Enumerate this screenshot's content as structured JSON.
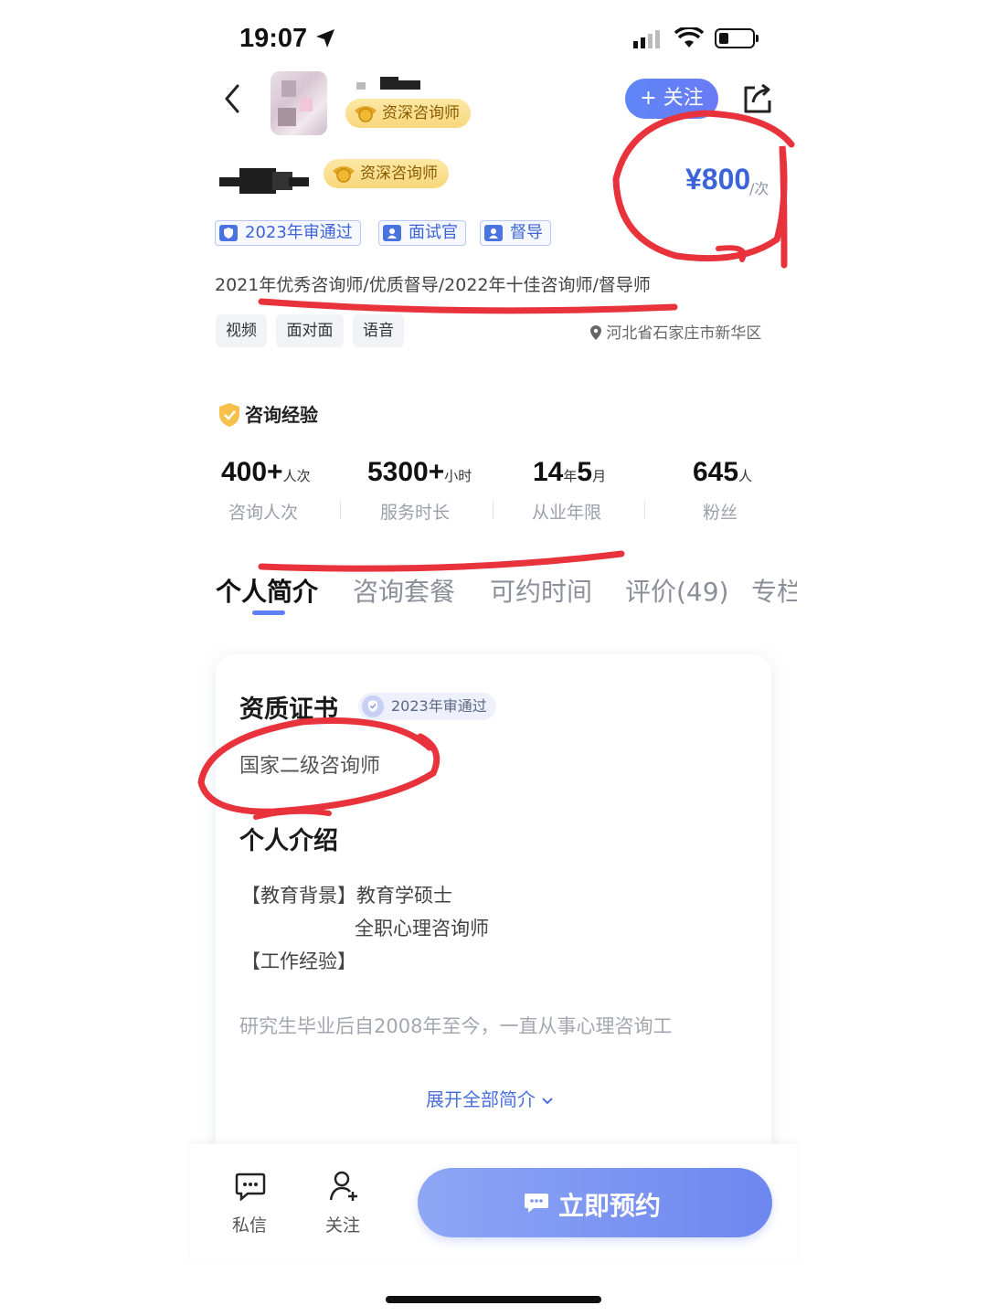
{
  "status_bar": {
    "time": "19:07"
  },
  "header": {
    "title_badge": "资深咨询师",
    "follow_label": "+ 关注"
  },
  "profile": {
    "title_badge": "资深咨询师",
    "price": "¥800",
    "price_unit": "/次",
    "tags": [
      "2023年审通过",
      "面试官",
      "督导"
    ],
    "honors": "2021年优秀咨询师/优质督导/2022年十佳咨询师/督导师",
    "modes": [
      "视频",
      "面对面",
      "语音"
    ],
    "location": "河北省石家庄市新华区"
  },
  "experience": {
    "title": "咨询经验",
    "stats": [
      {
        "value": "400+",
        "unit": "人次",
        "label": "咨询人次"
      },
      {
        "value": "5300+",
        "unit": "小时",
        "label": "服务时长"
      },
      {
        "value_a": "14",
        "unit_a": "年",
        "value_b": "5",
        "unit_b": "月",
        "label": "从业年限"
      },
      {
        "value": "645",
        "unit": "人",
        "label": "粉丝"
      }
    ]
  },
  "tabs": [
    "个人简介",
    "咨询套餐",
    "可约时间",
    "评价(49)",
    "专栏"
  ],
  "card": {
    "cert_title": "资质证书",
    "audit_badge": "2023年审通过",
    "cert": "国家二级咨询师",
    "intro_title": "个人介绍",
    "intro_lines": [
      "【教育背景】教育学硕士",
      "全职心理咨询师",
      "【工作经验】"
    ],
    "intro_preview": "研究生毕业后自2008年至今，一直从事心理咨询工",
    "expand_label": "展开全部简介"
  },
  "bottom": {
    "message_label": "私信",
    "follow_label": "关注",
    "book_label": "立即预约"
  },
  "colors": {
    "accent": "#5f7ef5",
    "price": "#3c63d9",
    "annotation": "#e8323c",
    "gold_badge": "#f7d77c"
  }
}
